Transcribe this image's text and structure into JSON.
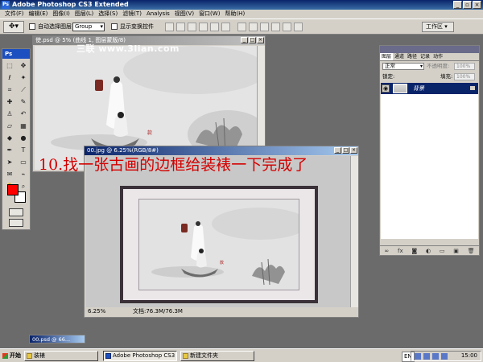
{
  "app": {
    "title": "Adobe Photoshop CS3 Extended",
    "logo": "Ps"
  },
  "menu": [
    "文件(F)",
    "编辑(E)",
    "图像(I)",
    "图层(L)",
    "选择(S)",
    "滤镜(T)",
    "Analysis",
    "视图(V)",
    "窗口(W)",
    "帮助(H)"
  ],
  "options": {
    "tool_icon": "move-tool-icon",
    "auto_select_label": "自动选择图层",
    "auto_select_value": "Group",
    "show_transform_label": "显示变换控件",
    "workspace_label": "工作区 ▾"
  },
  "tools_panel": {
    "badge": "Ps",
    "foreground_color": "#ff0000",
    "background_color": "#ffffff"
  },
  "documents": [
    {
      "title": "使.psd @ 5% (曲线 1, 图层蒙版/8)",
      "state": "inactive"
    },
    {
      "title": "00.jpg @ 6.25%(RGB/8#)",
      "state": "active",
      "zoom": "6.25%",
      "doc_info": "文档:76.3M/76.3M"
    }
  ],
  "caption": "10.找一张古画的边框给装裱一下完成了",
  "watermark": "三联 www.3lian.com",
  "layers_panel": {
    "tabs": [
      "图层",
      "通道",
      "路径",
      "记录",
      "动作"
    ],
    "blend_mode": "正常",
    "opacity_label": "不透明度:",
    "opacity_value": "100%",
    "lock_label": "锁定:",
    "fill_label": "填充:",
    "fill_value": "100%",
    "layers": [
      {
        "name": "背景",
        "visible": true,
        "locked": true,
        "selected": true
      }
    ],
    "footer_icons": [
      "link-icon",
      "fx-icon",
      "mask-icon",
      "adjustment-icon",
      "folder-icon",
      "new-layer-icon",
      "trash-icon"
    ]
  },
  "minimized_doc": {
    "title": "00.psd @ 66..."
  },
  "taskbar": {
    "start_label": "开始",
    "items": [
      {
        "label": "装裱",
        "type": "folder",
        "active": false
      },
      {
        "label": "Adobe Photoshop CS3 E...",
        "type": "ps",
        "active": true
      },
      {
        "label": "新建文件夹",
        "type": "folder",
        "active": false
      }
    ],
    "language": "EN",
    "clock": "15:00"
  }
}
